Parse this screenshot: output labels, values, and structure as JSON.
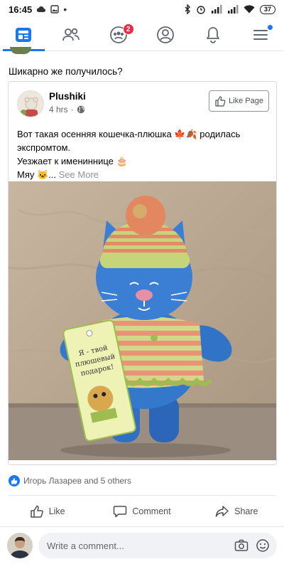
{
  "status_bar": {
    "time": "16:45",
    "battery": "37"
  },
  "nav": {
    "items": [
      {
        "name": "news-feed",
        "icon": "news-feed-icon",
        "active": true
      },
      {
        "name": "friends",
        "icon": "friends-icon"
      },
      {
        "name": "groups",
        "icon": "groups-icon",
        "badge": "2"
      },
      {
        "name": "profile",
        "icon": "profile-icon"
      },
      {
        "name": "notifications",
        "icon": "bell-icon"
      },
      {
        "name": "menu",
        "icon": "menu-icon",
        "dot": true
      }
    ]
  },
  "post": {
    "text": "Шикарно же получилось?"
  },
  "shared": {
    "page_name": "Plushiki",
    "time": "4 hrs",
    "like_page_label": "Like Page",
    "line1": "Вот такая осенняя кошечка-плюшка 🍁🍂 родилась",
    "line2": "экспромтом.",
    "line3": "Уезжает к имениннице 🎂",
    "line4": "Мяу 🐱...",
    "see_more": "See More",
    "tag_text": "Я - твой плюшевый подарок!"
  },
  "reactions": {
    "text": "Игорь Лазарев and 5 others"
  },
  "actions": {
    "like": "Like",
    "comment": "Comment",
    "share": "Share"
  },
  "comment": {
    "placeholder": "Write a comment..."
  },
  "colors": {
    "brand": "#1877f2",
    "badge": "#f02849"
  }
}
